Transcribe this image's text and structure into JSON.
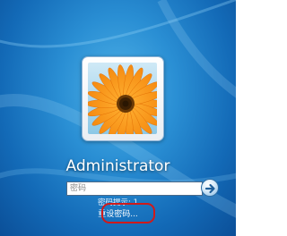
{
  "user": {
    "name": "Administrator",
    "avatar": "orange-gerbera-flower"
  },
  "login": {
    "password_placeholder": "密码",
    "submit_icon": "arrow-right-icon"
  },
  "hint": {
    "text": "密码提示: 1"
  },
  "reset": {
    "label": "重设密码..."
  },
  "colors": {
    "background": "#2a8fd4",
    "highlight": "#d01a1a",
    "flower_petal": "#f58a10"
  }
}
